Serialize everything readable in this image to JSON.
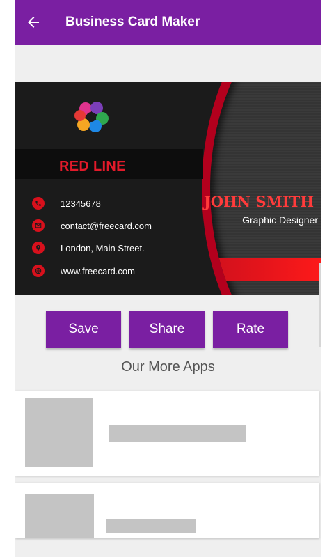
{
  "appbar": {
    "title": "Business Card Maker",
    "back_icon": "arrow-left-icon",
    "color": "#7a1fa2"
  },
  "card": {
    "brand": "RED LINE",
    "logo_icon": "multicolor-hands-logo-icon",
    "contacts": [
      {
        "icon": "phone-icon",
        "text": "12345678"
      },
      {
        "icon": "email-icon",
        "text": "contact@freecard.com"
      },
      {
        "icon": "location-icon",
        "text": "London, Main Street."
      },
      {
        "icon": "globe-icon",
        "text": "www.freecard.com"
      }
    ],
    "name": "JOHN SMITH",
    "title": "Graphic Designer",
    "accent_color": "#e21a2a"
  },
  "actions": {
    "save_label": "Save",
    "share_label": "Share",
    "rate_label": "Rate"
  },
  "more_apps": {
    "heading": "Our More Apps"
  }
}
